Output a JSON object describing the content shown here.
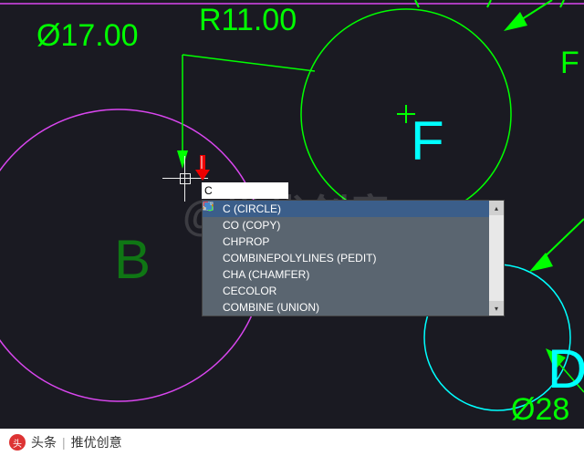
{
  "dimensions": {
    "diameter_17": "Ø17.00",
    "radius_11": "R11.00",
    "right_f": "F",
    "diameter_28": "Ø28"
  },
  "letters": {
    "f": "F",
    "d": "D",
    "b_partial": "B"
  },
  "watermark": "@推优创意",
  "command_input": {
    "value": "C"
  },
  "autocomplete": {
    "items": [
      {
        "label": "C (CIRCLE)",
        "icon": "circle"
      },
      {
        "label": "CO (COPY)",
        "icon": "copy"
      },
      {
        "label": "CHPROP",
        "icon": "props"
      },
      {
        "label": "COMBINEPOLYLINES (PEDIT)",
        "icon": "poly"
      },
      {
        "label": "CHA (CHAMFER)",
        "icon": "chamfer"
      },
      {
        "label": "CECOLOR",
        "icon": "color"
      },
      {
        "label": "COMBINE (UNION)",
        "icon": "union"
      }
    ],
    "selected_index": 0
  },
  "footer": {
    "source_label": "头条",
    "author": "推优创意"
  }
}
